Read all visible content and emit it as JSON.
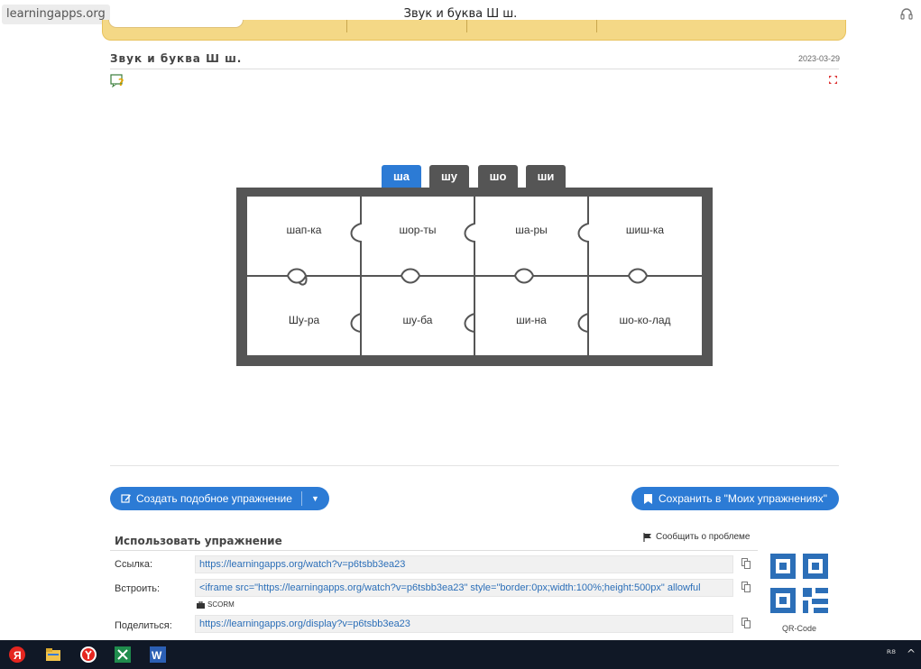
{
  "browser": {
    "domain": "learningapps.org",
    "tab_title": "Звук и буква Ш ш."
  },
  "header": {
    "title": "Звук и буква Ш ш.",
    "date": "2023-03-29"
  },
  "exercise": {
    "tabs": [
      {
        "label": "ша",
        "active": true
      },
      {
        "label": "шу",
        "active": false
      },
      {
        "label": "шо",
        "active": false
      },
      {
        "label": "ши",
        "active": false
      }
    ],
    "pieces": [
      "шап-ка",
      "шор-ты",
      "ша-ры",
      "шиш-ка",
      "Шу-ра",
      "шу-ба",
      "ши-на",
      "шо-ко-лад"
    ]
  },
  "actions": {
    "create_label": "Создать подобное упражнение",
    "save_label": "Сохранить в \"Моих упражнениях\""
  },
  "use_section": {
    "title": "Использовать упражнение",
    "report_label": "Сообщить о проблеме",
    "link_label": "Ссылка:",
    "link_value": "https://learningapps.org/watch?v=p6tsbb3ea23",
    "embed_label": "Встроить:",
    "embed_value": "<iframe src=\"https://learningapps.org/watch?v=p6tsbb3ea23\" style=\"border:0px;width:100%;height:500px\" allowful",
    "scorm_label": "SCORM",
    "share_label": "Поделиться:",
    "share_value": "https://learningapps.org/display?v=p6tsbb3ea23",
    "qr_label": "QR-Code"
  },
  "taskbar": {
    "icons": [
      "yandex-icon",
      "file-explorer-icon",
      "yandex-browser-icon",
      "excel-icon",
      "word-icon"
    ],
    "tray_text": "ᴿ⁸"
  },
  "colors": {
    "accent": "#2c7bd5",
    "board": "#555555",
    "nav": "#f4d886",
    "taskbar": "#101826"
  }
}
